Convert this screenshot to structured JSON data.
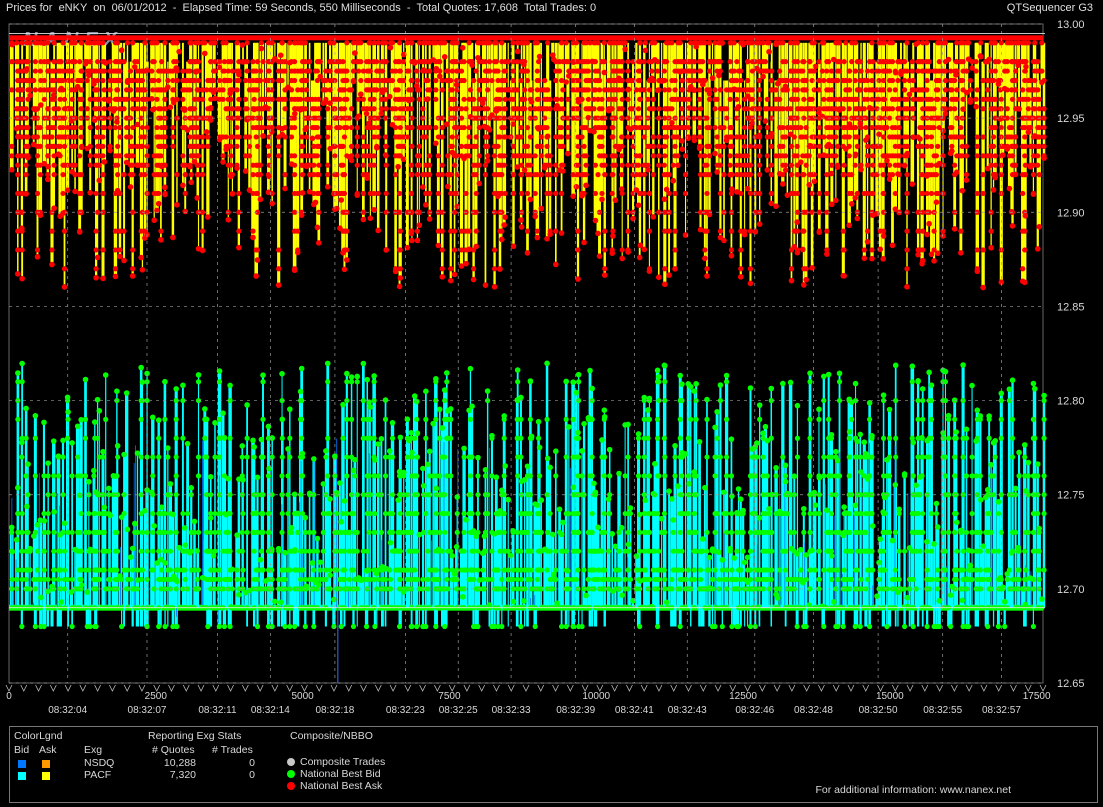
{
  "header": {
    "title": "Prices for  eNKY  on  06/01/2012  -  Elapsed Time: 59 Seconds, 550 Milliseconds  -  Total Quotes: 17,608  Total Trades: 0",
    "app": "QTSequencer G3"
  },
  "watermark": "NANEX",
  "colors": {
    "background": "#000000",
    "grid": "#9a9a9a",
    "nsdq_bid": "#0077ff",
    "nsdq_ask": "#ff9900",
    "pacf_bid": "#00ffff",
    "pacf_ask": "#ffff00",
    "nbb": "#00ff00",
    "nbo": "#ff0000",
    "composite_trades": "#c8c8c8"
  },
  "chart_data": {
    "type": "scatter",
    "title": "",
    "xlabel": "",
    "ylabel": "",
    "xlim": [
      0,
      17608
    ],
    "ylim": [
      12.65,
      13.0
    ],
    "grid": true,
    "y_ticks": [
      "13.00",
      "12.95",
      "12.90",
      "12.85",
      "12.80",
      "12.75",
      "12.70",
      "12.65"
    ],
    "x_ticks": [
      {
        "value": 0,
        "label": "0"
      },
      {
        "value": 2500,
        "label": "2500"
      },
      {
        "value": 5000,
        "label": "5000"
      },
      {
        "value": 7500,
        "label": "7500"
      },
      {
        "value": 10000,
        "label": "10000"
      },
      {
        "value": 12500,
        "label": "12500"
      },
      {
        "value": 15000,
        "label": "15000"
      },
      {
        "value": 17500,
        "label": "17500"
      }
    ],
    "time_labels": [
      {
        "value": 1000,
        "label": "08:32:04"
      },
      {
        "value": 2350,
        "label": "08:32:07"
      },
      {
        "value": 3550,
        "label": "08:32:11"
      },
      {
        "value": 4450,
        "label": "08:32:14"
      },
      {
        "value": 5550,
        "label": "08:32:18"
      },
      {
        "value": 6750,
        "label": "08:32:23"
      },
      {
        "value": 7650,
        "label": "08:32:25"
      },
      {
        "value": 8550,
        "label": "08:32:33"
      },
      {
        "value": 9650,
        "label": "08:32:39"
      },
      {
        "value": 10650,
        "label": "08:32:41"
      },
      {
        "value": 11550,
        "label": "08:32:43"
      },
      {
        "value": 12700,
        "label": "08:32:46"
      },
      {
        "value": 13700,
        "label": "08:32:48"
      },
      {
        "value": 14800,
        "label": "08:32:50"
      },
      {
        "value": 15900,
        "label": "08:32:55"
      },
      {
        "value": 16900,
        "label": "08:32:57"
      }
    ],
    "series": [
      {
        "name": "National Best Ask",
        "role": "nbo",
        "range": [
          12.86,
          12.99
        ],
        "levels": [
          12.99,
          12.98,
          12.975,
          12.97,
          12.965,
          12.96,
          12.955,
          12.95,
          12.945,
          12.94,
          12.935,
          12.93,
          12.925,
          12.92,
          12.91,
          12.9,
          12.89,
          12.88,
          12.87,
          12.86
        ]
      },
      {
        "name": "National Best Bid",
        "role": "nbb",
        "range": [
          12.67,
          12.82
        ],
        "levels": [
          12.82,
          12.81,
          12.8,
          12.79,
          12.78,
          12.77,
          12.76,
          12.75,
          12.74,
          12.73,
          12.72,
          12.71,
          12.705,
          12.7,
          12.69,
          12.68,
          12.67
        ]
      }
    ],
    "annotations": [
      {
        "type": "reference_line",
        "y": 12.995
      },
      {
        "type": "reference_line",
        "y": 12.69
      },
      {
        "type": "marker_line",
        "x": 5600
      }
    ]
  },
  "legend": {
    "colorlgnd": "ColorLgnd",
    "bid": "Bid",
    "ask": "Ask",
    "exg": "Exg",
    "stats_title": "Reporting Exg Stats",
    "quotes_header": "# Quotes",
    "trades_header": "# Trades",
    "composite_title": "Composite/NBBO",
    "rows": [
      {
        "exg": "NSDQ",
        "quotes": "10,288",
        "trades": "0"
      },
      {
        "exg": "PACF",
        "quotes": "7,320",
        "trades": "0"
      }
    ],
    "composite_items": [
      "Composite Trades",
      "National Best Bid",
      "National Best Ask"
    ],
    "footer": "For additional information: www.nanex.net"
  }
}
